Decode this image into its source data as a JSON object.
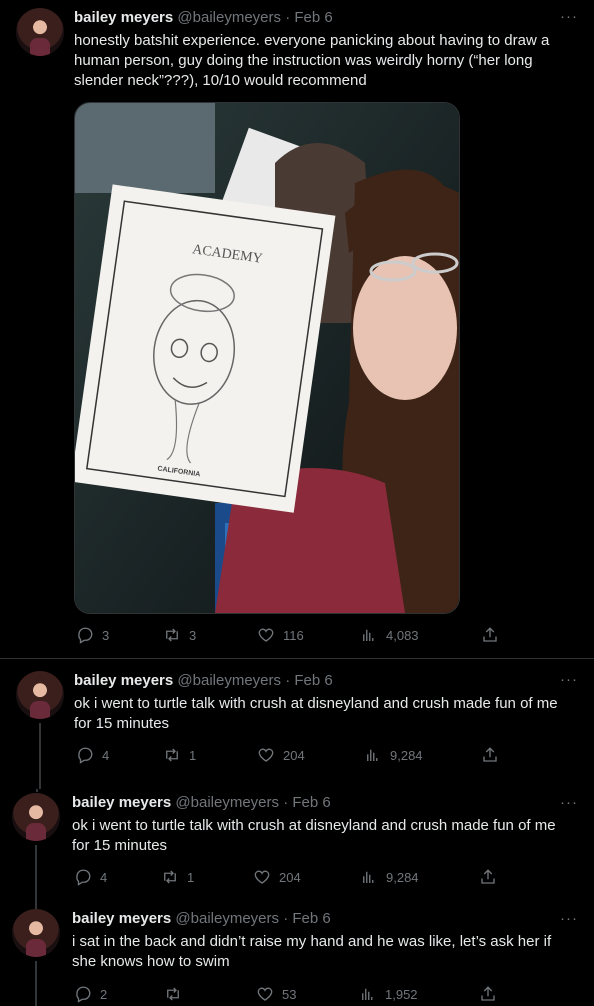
{
  "tweets": [
    {
      "name": "bailey meyers",
      "handle": "@baileymeyers",
      "date": "Feb 6",
      "text": "honestly batshit experience. everyone panicking about having to draw a human person, guy doing the instruction was weirdly horny (“her long slender neck”???), 10/10 would recommend",
      "replies": "3",
      "retweets": "3",
      "likes": "116",
      "views": "4,083"
    },
    {
      "name": "bailey meyers",
      "handle": "@baileymeyers",
      "date": "Feb 6",
      "text": "ok i went to turtle talk with crush at disneyland and crush made fun of me for 15 minutes",
      "replies": "4",
      "retweets": "1",
      "likes": "204",
      "views": "9,284"
    },
    {
      "name": "bailey meyers",
      "handle": "@baileymeyers",
      "date": "Feb 6",
      "text": "ok i went to turtle talk with crush at disneyland and crush made fun of me for 15 minutes",
      "replies": "4",
      "retweets": "1",
      "likes": "204",
      "views": "9,284"
    },
    {
      "name": "bailey meyers",
      "handle": "@baileymeyers",
      "date": "Feb 6",
      "text": "i sat in the back and didn’t raise my hand and he was like, let’s ask her if she knows how to swim",
      "replies": "2",
      "retweets": "",
      "likes": "53",
      "views": "1,952"
    }
  ],
  "photo": {
    "academy_text": "ACADEMY",
    "california_text": "CALIFORNIA"
  },
  "more_label": "···"
}
